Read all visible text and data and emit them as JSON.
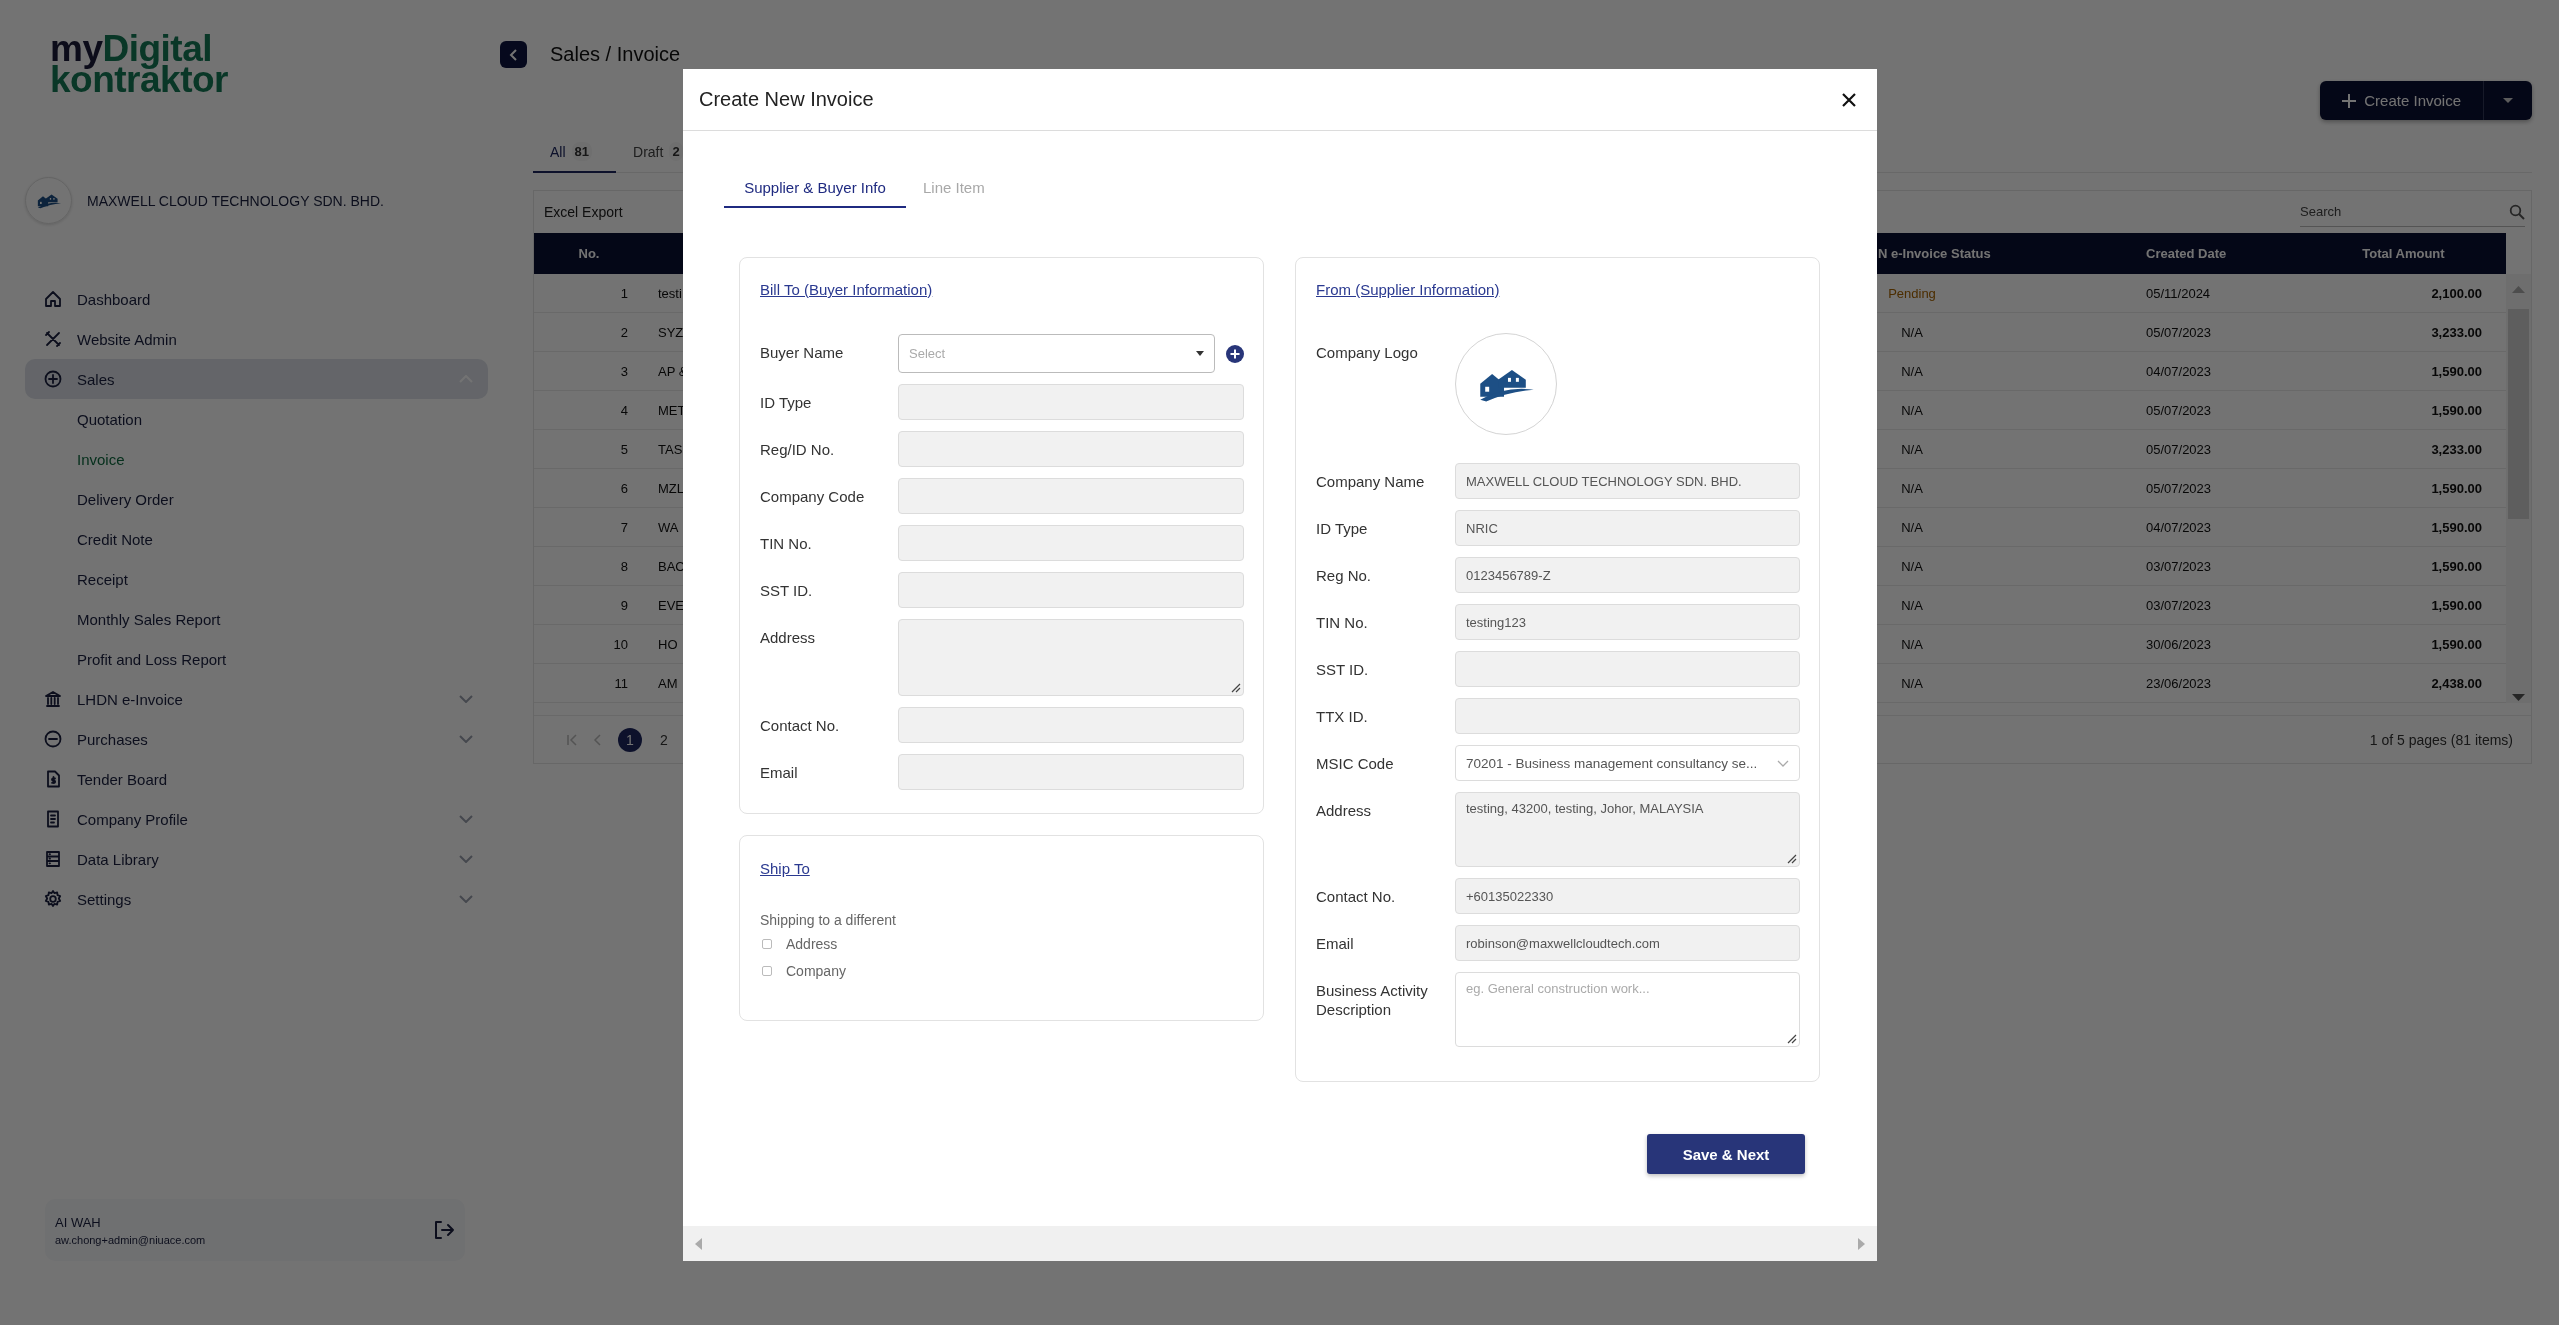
{
  "sidebar": {
    "logo": {
      "prefix": "my",
      "highlight": "Digital",
      "second_line": "kontraktor"
    },
    "company": "MAXWELL CLOUD TECHNOLOGY SDN. BHD.",
    "nav": [
      {
        "label": "Dashboard"
      },
      {
        "label": "Website Admin"
      },
      {
        "label": "Sales",
        "expanded": true,
        "children": [
          {
            "label": "Quotation",
            "selected": false
          },
          {
            "label": "Invoice",
            "selected": true
          },
          {
            "label": "Delivery Order",
            "selected": false
          },
          {
            "label": "Credit Note",
            "selected": false
          },
          {
            "label": "Receipt",
            "selected": false
          },
          {
            "label": "Monthly Sales Report",
            "selected": false
          },
          {
            "label": "Profit and Loss Report",
            "selected": false
          }
        ]
      },
      {
        "label": "LHDN e-Invoice",
        "expanded": false
      },
      {
        "label": "Purchases",
        "expanded": false
      },
      {
        "label": "Tender Board"
      },
      {
        "label": "Company Profile",
        "expanded": false
      },
      {
        "label": "Data Library",
        "expanded": false
      },
      {
        "label": "Settings",
        "expanded": false
      }
    ],
    "user": {
      "name": "AI WAH",
      "email": "aw.chong+admin@niuace.com"
    }
  },
  "page": {
    "title": "Sales / Invoice",
    "create_button": "Create Invoice",
    "tabs": [
      {
        "label": "All",
        "count": "81",
        "selected": true
      },
      {
        "label": "Draft",
        "count": "2",
        "selected": false
      }
    ],
    "toolbar": {
      "export": "Excel Export",
      "search_placeholder": "Search"
    },
    "table": {
      "columns": [
        "No.",
        "N e-Invoice Status",
        "Created Date",
        "Total Amount"
      ],
      "rows": [
        {
          "no": "1",
          "column_2": "testi",
          "status": "Pending",
          "kind": "pending",
          "created_date": "05/11/2024",
          "total_amount": "2,100.00"
        },
        {
          "no": "2",
          "column_2": "SYZ",
          "status": "N/A",
          "kind": "none",
          "created_date": "05/07/2023",
          "total_amount": "3,233.00"
        },
        {
          "no": "3",
          "column_2": "AP &",
          "status": "N/A",
          "kind": "none",
          "created_date": "04/07/2023",
          "total_amount": "1,590.00"
        },
        {
          "no": "4",
          "column_2": "MET",
          "status": "N/A",
          "kind": "none",
          "created_date": "05/07/2023",
          "total_amount": "1,590.00"
        },
        {
          "no": "5",
          "column_2": "TAS",
          "status": "N/A",
          "kind": "none",
          "created_date": "05/07/2023",
          "total_amount": "3,233.00"
        },
        {
          "no": "6",
          "column_2": "MZL",
          "status": "N/A",
          "kind": "none",
          "created_date": "05/07/2023",
          "total_amount": "1,590.00"
        },
        {
          "no": "7",
          "column_2": "WA",
          "status": "N/A",
          "kind": "none",
          "created_date": "04/07/2023",
          "total_amount": "1,590.00"
        },
        {
          "no": "8",
          "column_2": "BAC",
          "status": "N/A",
          "kind": "none",
          "created_date": "03/07/2023",
          "total_amount": "1,590.00"
        },
        {
          "no": "9",
          "column_2": "EVE",
          "status": "N/A",
          "kind": "none",
          "created_date": "03/07/2023",
          "total_amount": "1,590.00"
        },
        {
          "no": "10",
          "column_2": "HO",
          "status": "N/A",
          "kind": "none",
          "created_date": "30/06/2023",
          "total_amount": "1,590.00"
        },
        {
          "no": "11",
          "column_2": "AM",
          "status": "N/A",
          "kind": "none",
          "created_date": "23/06/2023",
          "total_amount": "2,438.00"
        }
      ]
    },
    "pagination": {
      "pages": [
        {
          "label": "1",
          "selected": true
        },
        {
          "label": "2",
          "selected": false
        }
      ],
      "summary": "1 of 5 pages (81 items)"
    }
  },
  "modal": {
    "title": "Create New Invoice",
    "tabs": [
      {
        "label": "Supplier & Buyer Info",
        "selected": true
      },
      {
        "label": "Line Item",
        "selected": false
      }
    ],
    "bill_to": {
      "heading": "Bill To (Buyer Information)",
      "fields": [
        {
          "label": "Buyer Name",
          "kind": "dropdown",
          "placeholder": "Select",
          "disabled": false,
          "add_button": true
        },
        {
          "label": "ID Type",
          "kind": "input",
          "disabled": true
        },
        {
          "label": "Reg/ID No.",
          "kind": "input",
          "disabled": true
        },
        {
          "label": "Company Code",
          "kind": "input",
          "disabled": true
        },
        {
          "label": "TIN No.",
          "kind": "input",
          "disabled": true
        },
        {
          "label": "SST ID.",
          "kind": "input",
          "disabled": true
        },
        {
          "label": "Address",
          "kind": "textarea",
          "disabled": true
        },
        {
          "label": "Contact No.",
          "kind": "input",
          "disabled": true
        },
        {
          "label": "Email",
          "kind": "input",
          "disabled": true
        }
      ]
    },
    "ship_to": {
      "heading": "Ship To",
      "prompt": "Shipping to a different",
      "options": [
        {
          "label": "Address",
          "checked": false
        },
        {
          "label": "Company",
          "checked": false
        }
      ]
    },
    "supplier": {
      "heading": "From (Supplier Information)",
      "fields": [
        {
          "label": "Company Logo",
          "kind": "logo"
        },
        {
          "label": "Company Name",
          "kind": "input",
          "value": "MAXWELL CLOUD TECHNOLOGY SDN. BHD.",
          "disabled": true
        },
        {
          "label": "ID Type",
          "kind": "input",
          "value": "NRIC",
          "disabled": true
        },
        {
          "label": "Reg No.",
          "kind": "input",
          "value": "0123456789-Z",
          "disabled": true
        },
        {
          "label": "TIN No.",
          "kind": "input",
          "value": "testing123",
          "disabled": true
        },
        {
          "label": "SST ID.",
          "kind": "input",
          "disabled": true
        },
        {
          "label": "TTX ID.",
          "kind": "input",
          "disabled": true
        },
        {
          "label": "MSIC Code",
          "kind": "select",
          "value": "70201 - Business management consultancy se...",
          "disabled": false
        },
        {
          "label": "Address",
          "kind": "textarea",
          "value": "testing, 43200, testing, Johor, MALAYSIA",
          "disabled": true
        },
        {
          "label": "Contact No.",
          "kind": "input",
          "value": "+60135022330",
          "disabled": true
        },
        {
          "label": "Email",
          "kind": "input",
          "value": "robinson@maxwellcloudtech.com",
          "disabled": true
        },
        {
          "label": "Business Activity Description",
          "kind": "textarea",
          "placeholder": "eg. General construction work...",
          "disabled": false
        }
      ]
    },
    "save_button": "Save & Next"
  }
}
